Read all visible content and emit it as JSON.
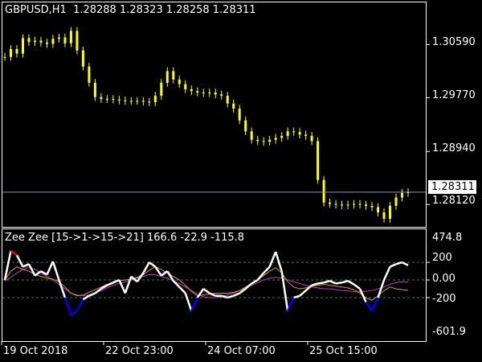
{
  "main_chart": {
    "symbol_label": "GBPUSD,H1",
    "ohlc": [
      "1.28288",
      "1.28323",
      "1.28258",
      "1.28311"
    ],
    "current_price_label": "1.28311",
    "y_tick_labels": [
      "1.30590",
      "1.29770",
      "1.28940",
      "1.28120"
    ]
  },
  "indicator": {
    "title": "Zee Zee [15->1->15->21]",
    "values": [
      "166.6",
      "-22.9",
      "-115.8"
    ],
    "max_label": "474.8",
    "min_label": "-601.9",
    "y_tick_labels": [
      "200",
      "0.00",
      "-200"
    ]
  },
  "x_tick_labels": [
    "19 Oct 2018",
    "22 Oct 23:00",
    "24 Oct 07:00",
    "25 Oct 15:00"
  ],
  "colors": {
    "background": "#000000",
    "candle": "#ffff00",
    "frame": "#ffffff",
    "current_line": "#8a94b8",
    "level_line": "#2e8b2e",
    "osc_main": "#ffffff",
    "osc_up_extreme": "#ff0000",
    "osc_down_extreme": "#0000ff",
    "signal_slow": "#cc33cc",
    "signal_fast": "#d4a017"
  },
  "chart_data": [
    {
      "type": "line",
      "title": "GBPUSD,H1",
      "ylim": [
        1.279,
        1.3103
      ],
      "current_price": 1.28311,
      "series": [
        {
          "name": "GBPUSD,H1",
          "values": [
            1.304,
            1.3052,
            1.3045,
            1.3069,
            1.3063,
            1.3065,
            1.3062,
            1.306,
            1.3068,
            1.307,
            1.3061,
            1.308,
            1.305,
            1.3025,
            1.3,
            1.2978,
            1.2975,
            1.2975,
            1.2974,
            1.2973,
            1.2972,
            1.2972,
            1.2972,
            1.2971,
            1.297,
            1.298,
            1.3,
            1.3018,
            1.3005,
            1.2998,
            1.299,
            1.2987,
            1.2985,
            1.2984,
            1.2985,
            1.2982,
            1.298,
            1.2968,
            1.296,
            1.2942,
            1.2925,
            1.2912,
            1.291,
            1.2909,
            1.2912,
            1.2915,
            1.2918,
            1.2925,
            1.2924,
            1.292,
            1.2918,
            1.291,
            1.285,
            1.2815,
            1.2813,
            1.2812,
            1.2811,
            1.2812,
            1.2813,
            1.2812,
            1.281,
            1.2808,
            1.28,
            1.279,
            1.281,
            1.2823,
            1.283,
            1.2831
          ]
        }
      ]
    },
    {
      "type": "line",
      "title": "Zee Zee [15->1->15->21]",
      "ylim": [
        -601.9,
        474.8
      ],
      "levels": [
        200,
        0,
        -200
      ],
      "series": [
        {
          "name": "Zee Zee",
          "values": [
            0,
            330,
            280,
            150,
            180,
            50,
            100,
            60,
            210,
            0,
            -200,
            -400,
            -350,
            -220,
            -180,
            -150,
            -100,
            -60,
            -30,
            0,
            -150,
            40,
            -20,
            80,
            200,
            150,
            50,
            100,
            -10,
            -80,
            -150,
            -350,
            -200,
            -100,
            -150,
            -180,
            -180,
            -200,
            -180,
            -150,
            -100,
            -40,
            0,
            80,
            150,
            320,
            100,
            -350,
            -200,
            -180,
            -120,
            -60,
            -40,
            -30,
            -10,
            -40,
            -30,
            -10,
            -50,
            -100,
            -250,
            -350,
            -200,
            0,
            150,
            180,
            200,
            166.6
          ]
        },
        {
          "name": "slow signal",
          "values": [
            -10,
            30,
            80,
            120,
            140,
            120,
            80,
            40,
            0,
            -50,
            -100,
            -150,
            -170,
            -180,
            -170,
            -150,
            -120,
            -90,
            -60,
            -40,
            -20,
            0,
            20,
            40,
            60,
            60,
            40,
            20,
            -10,
            -40,
            -80,
            -120,
            -160,
            -190,
            -200,
            -200,
            -190,
            -170,
            -150,
            -120,
            -90,
            -60,
            -30,
            0,
            20,
            30,
            20,
            0,
            -20,
            -40,
            -60,
            -80,
            -90,
            -100,
            -100,
            -110,
            -120,
            -125,
            -130,
            -130,
            -130,
            -120,
            -100,
            -80,
            -50,
            -30,
            -20,
            -22.9
          ]
        },
        {
          "name": "fast signal",
          "values": [
            0,
            100,
            150,
            120,
            100,
            60,
            40,
            20,
            10,
            -20,
            -80,
            -150,
            -180,
            -170,
            -140,
            -110,
            -80,
            -50,
            -30,
            -10,
            0,
            10,
            30,
            60,
            110,
            150,
            120,
            80,
            40,
            0,
            -60,
            -130,
            -180,
            -170,
            -160,
            -150,
            -150,
            -150,
            -140,
            -120,
            -80,
            -40,
            0,
            50,
            100,
            140,
            80,
            -20,
            -80,
            -100,
            -90,
            -70,
            -60,
            -50,
            -60,
            -70,
            -80,
            -90,
            -110,
            -150,
            -200,
            -230,
            -180,
            -120,
            -80,
            -100,
            -110,
            -115.8
          ]
        }
      ]
    }
  ]
}
